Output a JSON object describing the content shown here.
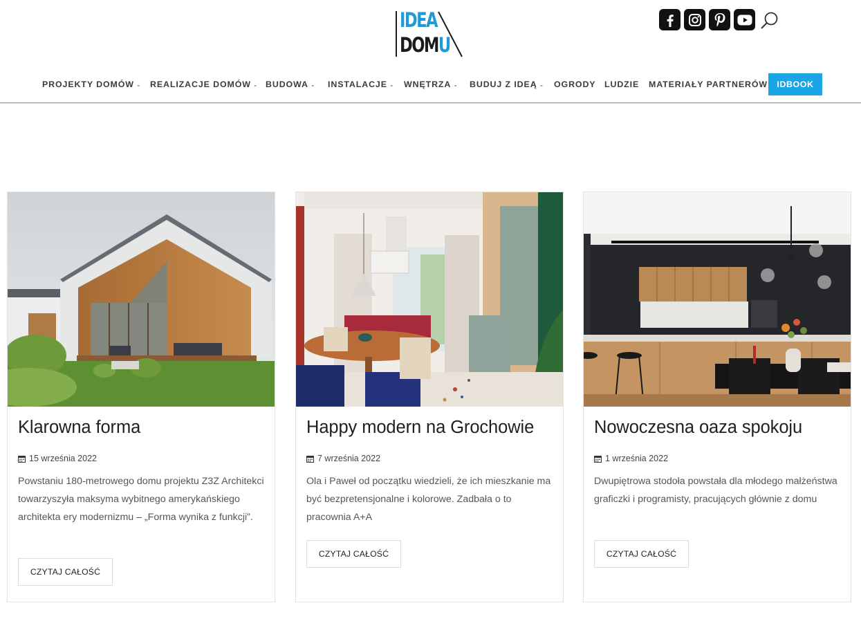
{
  "brand": {
    "logo_line1": "IDEA",
    "logo_line2_prefix": "DOM",
    "logo_line2_suffix": "U",
    "accent_color": "#1f9ad6",
    "button_color": "#1aa6e6"
  },
  "social_icons": [
    "facebook-icon",
    "instagram-icon",
    "pinterest-icon",
    "youtube-icon",
    "search-icon"
  ],
  "nav": {
    "items": [
      {
        "label": "PROJEKTY DOMÓW",
        "dropdown": true
      },
      {
        "label": "REALIZACJE DOMÓW",
        "dropdown": true
      },
      {
        "label": "BUDOWA",
        "dropdown": true
      },
      {
        "label": "INSTALACJE",
        "dropdown": true
      },
      {
        "label": "WNĘTRZA",
        "dropdown": true
      },
      {
        "label": "BUDUJ Z IDEĄ",
        "dropdown": true
      },
      {
        "label": "OGRODY",
        "dropdown": false
      },
      {
        "label": "LUDZIE",
        "dropdown": false
      },
      {
        "label": "MATERIAŁY PARTNERÓW",
        "dropdown": false
      }
    ],
    "cta_label": "IDBOOK"
  },
  "articles": [
    {
      "title": "Klarowna forma",
      "date": "15 września 2022",
      "excerpt": "Powstaniu 180-metrowego domu projektu Z3Z Architekci towarzyszyła maksyma wybitnego amerykańskiego architekta ery modernizmu – „Forma wynika z funkcji”.",
      "button_label": "CZYTAJ CAŁOŚĆ"
    },
    {
      "title": "Happy modern na Grochowie",
      "date": "7 września 2022",
      "excerpt": "Ola i Paweł od początku wiedzieli, że ich mieszkanie ma być bezpretensjonalne i kolorowe. Zadbała o to pracownia A+A",
      "button_label": "CZYTAJ CAŁOŚĆ"
    },
    {
      "title": "Nowoczesna oaza spokoju",
      "date": "1 września 2022",
      "excerpt": "Dwupiętrowa stodoła powstała dla młodego małżeństwa graficzki i programisty, pracujących głównie z domu",
      "button_label": "CZYTAJ CAŁOŚĆ"
    }
  ]
}
